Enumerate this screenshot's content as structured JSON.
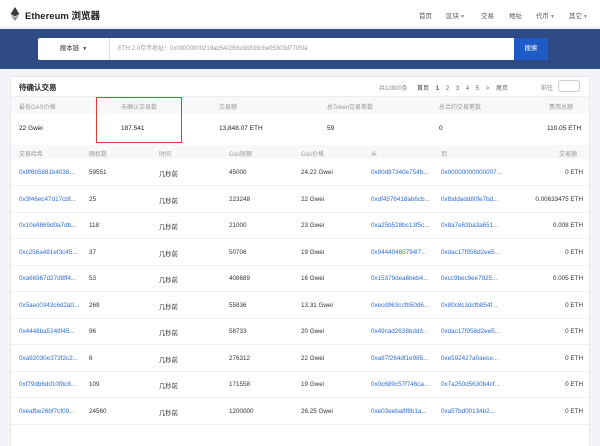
{
  "header": {
    "brand": "Ethereum 浏览器",
    "nav": [
      "首页",
      "区块",
      "交易",
      "地址",
      "代币",
      "其它"
    ]
  },
  "search": {
    "chain_label": "搜本链",
    "placeholder": "ETH 2.0存币地址：0x00000000219ab540356cbb839cbe05303d7705fa",
    "button_label": "搜索"
  },
  "panel": {
    "title": "待确认交易",
    "total": "共10800条",
    "pager": {
      "first": "首页",
      "pages": [
        "1",
        "2",
        "3",
        "4",
        "5"
      ],
      "next": ">",
      "last": "尾页",
      "current": "1"
    },
    "goto_label": "前往"
  },
  "summary": {
    "headers": [
      "最低GAS价格",
      "未确认交易数",
      "交易额",
      "总Token交易笔数",
      "总合约交易笔数",
      "费用总额"
    ],
    "values": [
      "22 Gwei",
      "187,541",
      "13,848.07 ETH",
      "59",
      "0",
      "110.05 ETH"
    ]
  },
  "table": {
    "headers": [
      "交易哈希",
      "随机数",
      "时间",
      "Gas限额",
      "Gas价格",
      "从",
      "到",
      "交易额"
    ],
    "rows": [
      {
        "hash": "0x9f6b5881b4038...",
        "nonce": "59551",
        "time": "几秒前",
        "gas_limit": "45000",
        "gas_price": "24.22 Gwei",
        "from": "0x80d87340e754b...",
        "to": "0x00000000000007...",
        "value": "0 ETH"
      },
      {
        "hash": "0x3f46ec47d17cbf...",
        "nonce": "25",
        "time": "几秒前",
        "gas_limit": "223248",
        "gas_price": "22 Gwei",
        "from": "0xdf4576418ab6cb...",
        "to": "0xfbddadd80fe7bd...",
        "value": "0.00633475 ETH"
      },
      {
        "hash": "0x10e8869d0a7db...",
        "nonce": "118",
        "time": "几秒前",
        "gas_limit": "21000",
        "gas_price": "23 Gwei",
        "from": "0xa25b528bc13f5c...",
        "to": "0x8a7e63ba3a651...",
        "value": "0.008 ETH"
      },
      {
        "hash": "0xc256a481ef3c45...",
        "nonce": "37",
        "time": "几秒前",
        "gas_limit": "50706",
        "gas_price": "19 Gwei",
        "from": "0x94440465794l7...",
        "to": "0xdac17f958d2ee5...",
        "value": "0 ETH"
      },
      {
        "hash": "0xa66967d27d8ff4...",
        "nonce": "53",
        "time": "几秒前",
        "gas_limit": "408689",
        "gas_price": "16 Gwei",
        "from": "0x15379dea6beb4...",
        "to": "0xcc9bec9ee7925...",
        "value": "0.005 ETH"
      },
      {
        "hash": "0x5aec0343c6d2a0...",
        "nonce": "269",
        "time": "几秒前",
        "gas_limit": "55836",
        "gas_price": "13.31 Gwei",
        "from": "0xecd963ccfb50d6...",
        "to": "0x80c8c3dcfb854f...",
        "value": "0 ETH"
      },
      {
        "hash": "0x4448ba5248f45...",
        "nonce": "96",
        "time": "几秒前",
        "gas_limit": "58733",
        "gas_price": "20 Gwei",
        "from": "0x49cad2638bdd3...",
        "to": "0xdac17f958d2ee5...",
        "value": "0 ETH"
      },
      {
        "hash": "0xa92030e373f2c2...",
        "nonce": "6",
        "time": "几秒前",
        "gas_limit": "276312",
        "gas_price": "22 Gwei",
        "from": "0xa87f264df1e985...",
        "to": "0xe592427a0aece...",
        "value": "0 ETH"
      },
      {
        "hash": "0xf79db6dd10f8c8...",
        "nonce": "109",
        "time": "几秒前",
        "gas_limit": "171558",
        "gas_price": "19 Gwei",
        "from": "0x0c689c57f746ca...",
        "to": "0x7a250d5630b4cf...",
        "value": "0 ETH"
      },
      {
        "hash": "0xeafbe26bf7cf09...",
        "nonce": "24560",
        "time": "几秒前",
        "gas_limit": "1200000",
        "gas_price": "26.25 Gwei",
        "from": "0xe03eeba8f8b1a...",
        "to": "0xa57bd00134b2...",
        "value": "0 ETH"
      }
    ]
  }
}
